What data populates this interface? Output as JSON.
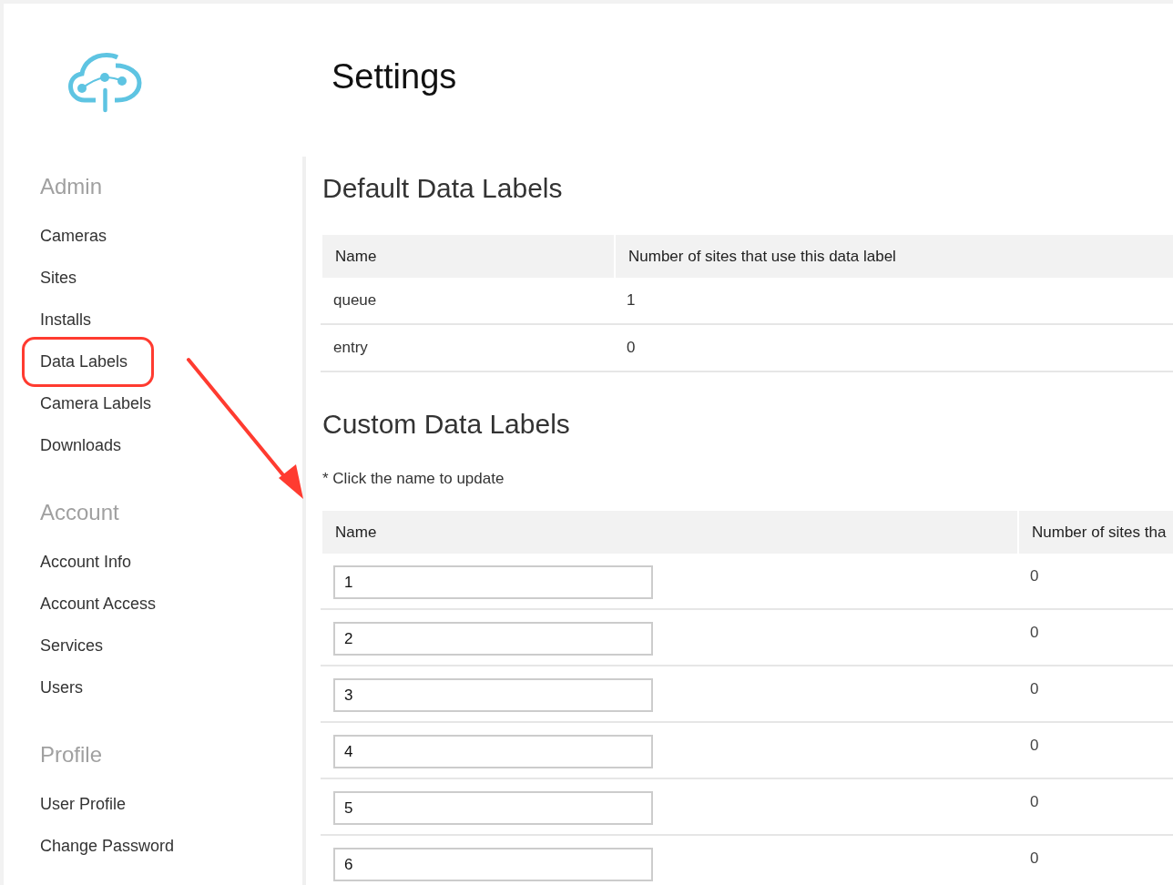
{
  "header": {
    "title": "Settings"
  },
  "sidebar": {
    "sections": [
      {
        "heading": "Admin",
        "items": [
          {
            "label": "Cameras",
            "highlighted": false
          },
          {
            "label": "Sites",
            "highlighted": false
          },
          {
            "label": "Installs",
            "highlighted": false
          },
          {
            "label": "Data Labels",
            "highlighted": true
          },
          {
            "label": "Camera Labels",
            "highlighted": false
          },
          {
            "label": "Downloads",
            "highlighted": false
          }
        ]
      },
      {
        "heading": "Account",
        "items": [
          {
            "label": "Account Info",
            "highlighted": false
          },
          {
            "label": "Account Access",
            "highlighted": false
          },
          {
            "label": "Services",
            "highlighted": false
          },
          {
            "label": "Users",
            "highlighted": false
          }
        ]
      },
      {
        "heading": "Profile",
        "items": [
          {
            "label": "User Profile",
            "highlighted": false
          },
          {
            "label": "Change Password",
            "highlighted": false
          }
        ]
      }
    ]
  },
  "content": {
    "sections": [
      {
        "heading": "Default Data Labels",
        "table": {
          "kind": "text",
          "columns": [
            "Name",
            "Number of sites that use this data label"
          ],
          "rows": [
            {
              "name": "queue",
              "sites": "1"
            },
            {
              "name": "entry",
              "sites": "0"
            }
          ]
        }
      },
      {
        "heading": "Custom Data Labels",
        "note": "* Click the name to update",
        "table": {
          "kind": "editable",
          "columns": [
            "Name",
            "Number of sites tha"
          ],
          "rows": [
            {
              "name": "1",
              "sites": "0"
            },
            {
              "name": "2",
              "sites": "0"
            },
            {
              "name": "3",
              "sites": "0"
            },
            {
              "name": "4",
              "sites": "0"
            },
            {
              "name": "5",
              "sites": "0"
            },
            {
              "name": "6",
              "sites": "0"
            }
          ]
        }
      }
    ]
  }
}
